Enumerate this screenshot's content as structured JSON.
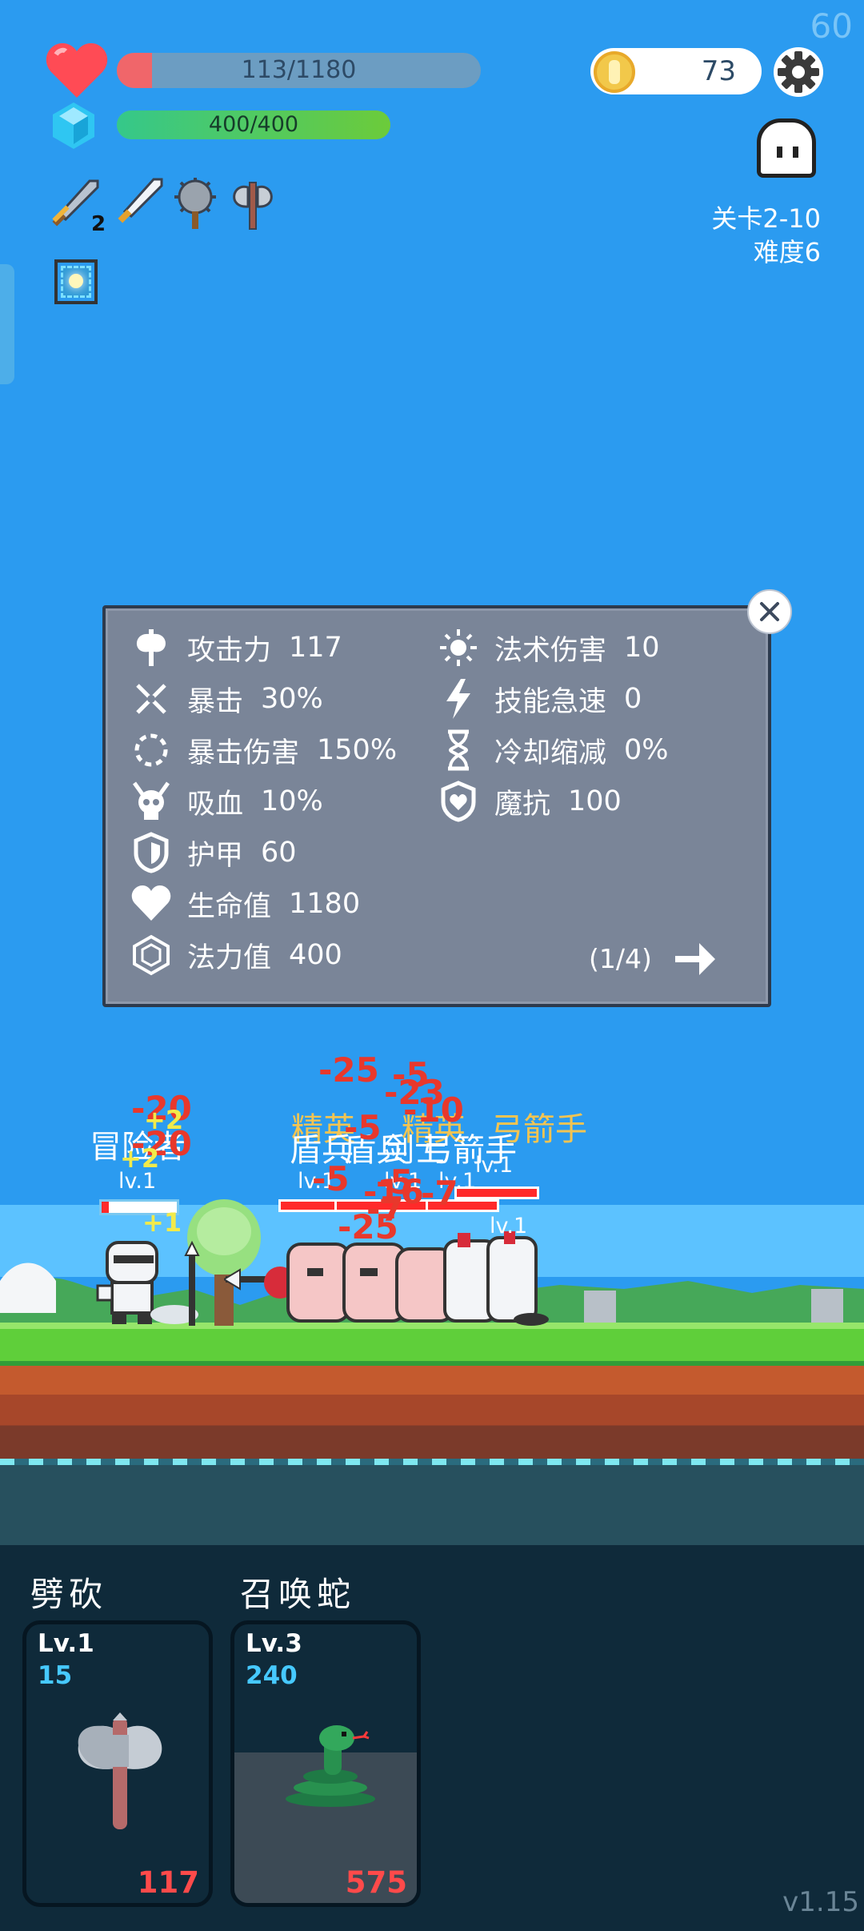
{
  "fps": "60",
  "hud": {
    "hp_text": "113/1180",
    "hp_fraction": 0.096,
    "mp_text": "400/400",
    "mp_fraction": 1.0,
    "coins": "73",
    "stage": "关卡2-10",
    "difficulty": "难度6",
    "weapon_badge": "2"
  },
  "stats_panel": {
    "left": [
      {
        "icon": "axe-icon",
        "label": "攻击力",
        "value": "117"
      },
      {
        "icon": "crit-icon",
        "label": "暴击",
        "value": "30%"
      },
      {
        "icon": "crit-damage-icon",
        "label": "暴击伤害",
        "value": "150%"
      },
      {
        "icon": "lifesteal-skull-icon",
        "label": "吸血",
        "value": "10%"
      },
      {
        "icon": "armor-shield-icon",
        "label": "护甲",
        "value": "60"
      },
      {
        "icon": "heart-icon",
        "label": "生命值",
        "value": "1180"
      },
      {
        "icon": "mana-hexagon-icon",
        "label": "法力值",
        "value": "400"
      }
    ],
    "right": [
      {
        "icon": "sun-icon",
        "label": "法术伤害",
        "value": "10"
      },
      {
        "icon": "lightning-icon",
        "label": "技能急速",
        "value": "0"
      },
      {
        "icon": "hourglass-icon",
        "label": "冷却缩减",
        "value": "0%"
      },
      {
        "icon": "magic-shield-icon",
        "label": "魔抗",
        "value": "100"
      }
    ],
    "page": "(1/4)"
  },
  "battle": {
    "hero_name": "冒险者",
    "hero_level": "lv.1",
    "hero_hp_fraction": 0.1,
    "hero_damage": [
      "-20",
      "-20"
    ],
    "hero_heals": [
      "+2",
      "+2",
      "+1"
    ],
    "enemy_names_elite": [
      "精英",
      "精英",
      "弓箭手"
    ],
    "enemy_names": [
      "盾兵",
      "盾兵",
      "剑士",
      "弓箭手"
    ],
    "enemy_levels": [
      "lv.1",
      "lv.1",
      "lv.1",
      "lv.1",
      "lv.1"
    ],
    "enemy_damage": [
      "-25",
      "-5",
      "-23",
      "-10",
      "-5",
      "-5",
      "-5",
      "-16",
      "-7",
      "-7",
      "-25"
    ]
  },
  "skills": [
    {
      "name": "劈砍",
      "level": "Lv.1",
      "cost": "15",
      "damage": "117",
      "icon": "battle-axe-icon"
    },
    {
      "name": "召唤蛇",
      "level": "Lv.3",
      "cost": "240",
      "damage": "575",
      "icon": "snake-icon"
    }
  ],
  "version": "v1.15",
  "colors": {
    "sky": "#2b9bf0",
    "hp": "#f0666a",
    "mp": "#6ccb3a",
    "panel": "#7a8598",
    "damage": "#e8382c",
    "cost": "#46c9ff"
  }
}
